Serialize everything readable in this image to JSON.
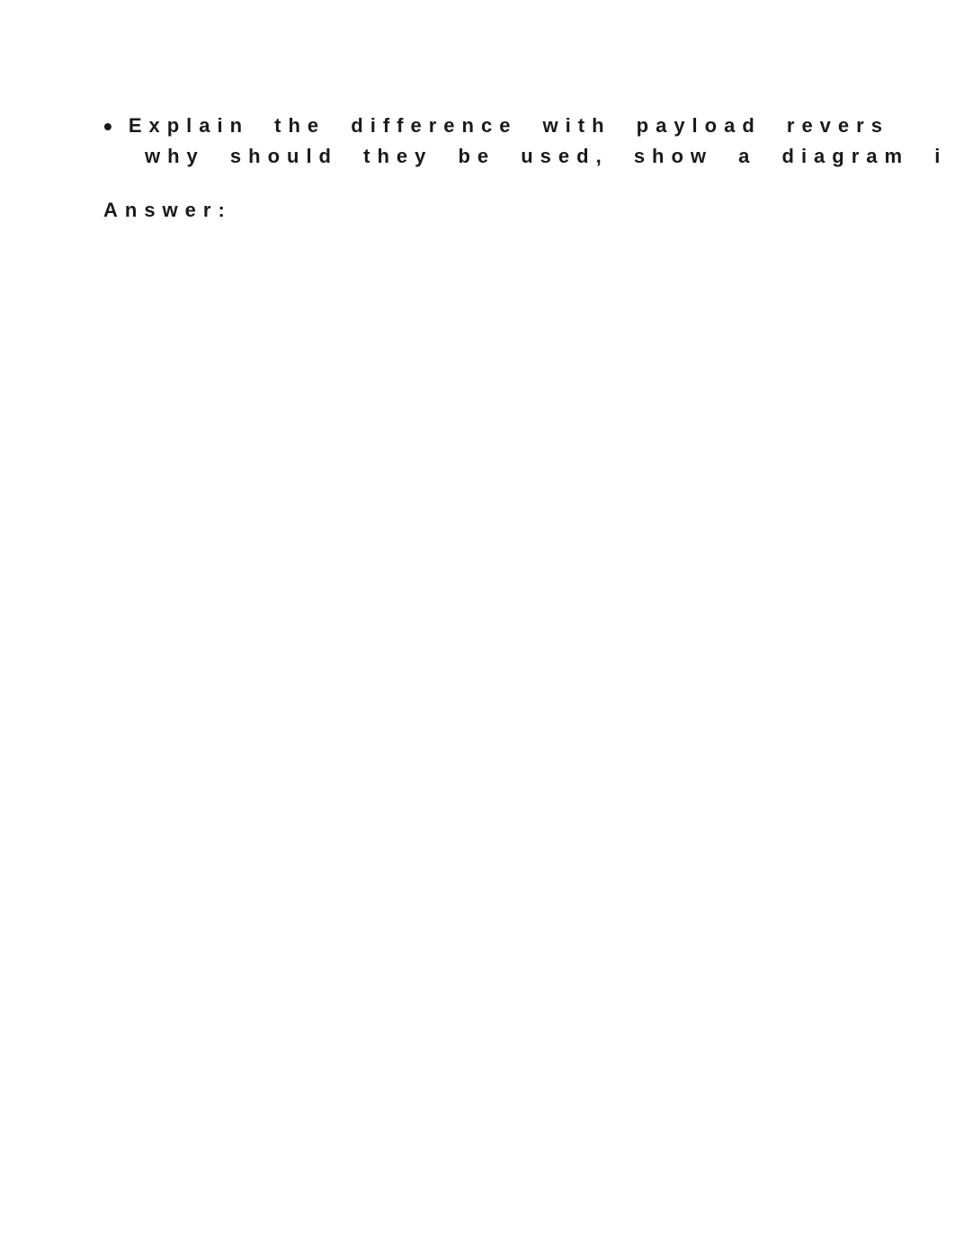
{
  "question": {
    "bullet": "•",
    "line1": "Explain the difference with payload revers",
    "line2": "why should they be used, show a diagram i"
  },
  "answer": {
    "label": "Answer:"
  }
}
